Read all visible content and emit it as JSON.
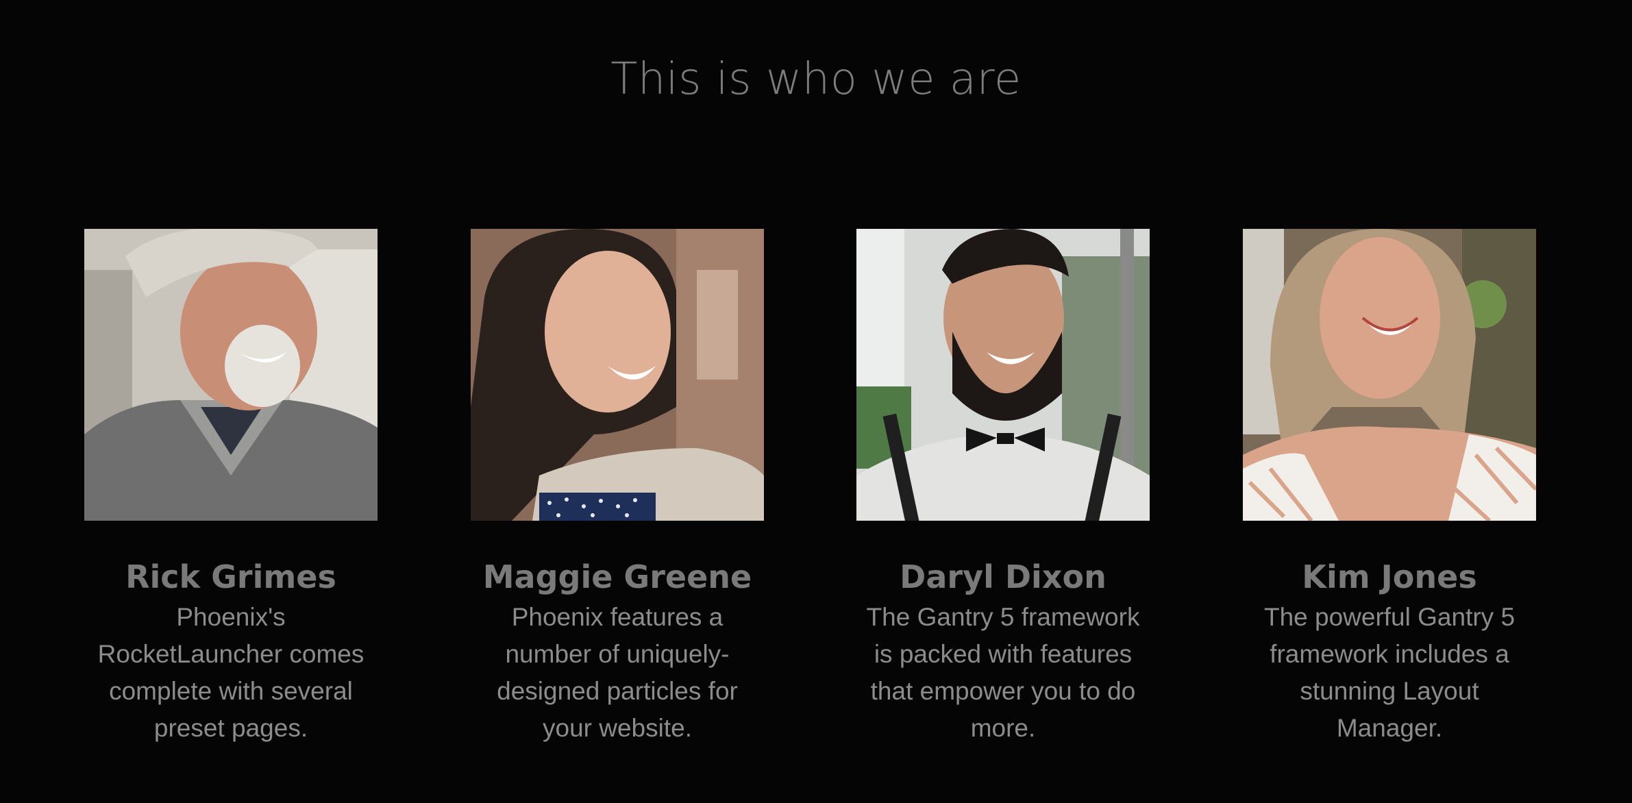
{
  "section": {
    "title": "This is who we are"
  },
  "team": [
    {
      "name": "Rick Grimes",
      "bio": "Phoenix's RocketLauncher comes complete with several preset pages.",
      "photo_icon": "portrait-man-cap-icon"
    },
    {
      "name": "Maggie Greene",
      "bio": "Phoenix features a number of uniquely-designed particles for your website.",
      "photo_icon": "portrait-woman-dark-hair-icon"
    },
    {
      "name": "Daryl Dixon",
      "bio": "The Gantry 5 framework is packed with features that empower you to do more.",
      "photo_icon": "portrait-man-beard-icon"
    },
    {
      "name": "Kim Jones",
      "bio": "The powerful Gantry 5 framework includes a stunning Layout Manager.",
      "photo_icon": "portrait-woman-blonde-icon"
    }
  ],
  "colors": {
    "background": "#050505",
    "title": "#7d7d7d",
    "name": "#7a7a7a",
    "bio": "#8c8c8c"
  }
}
